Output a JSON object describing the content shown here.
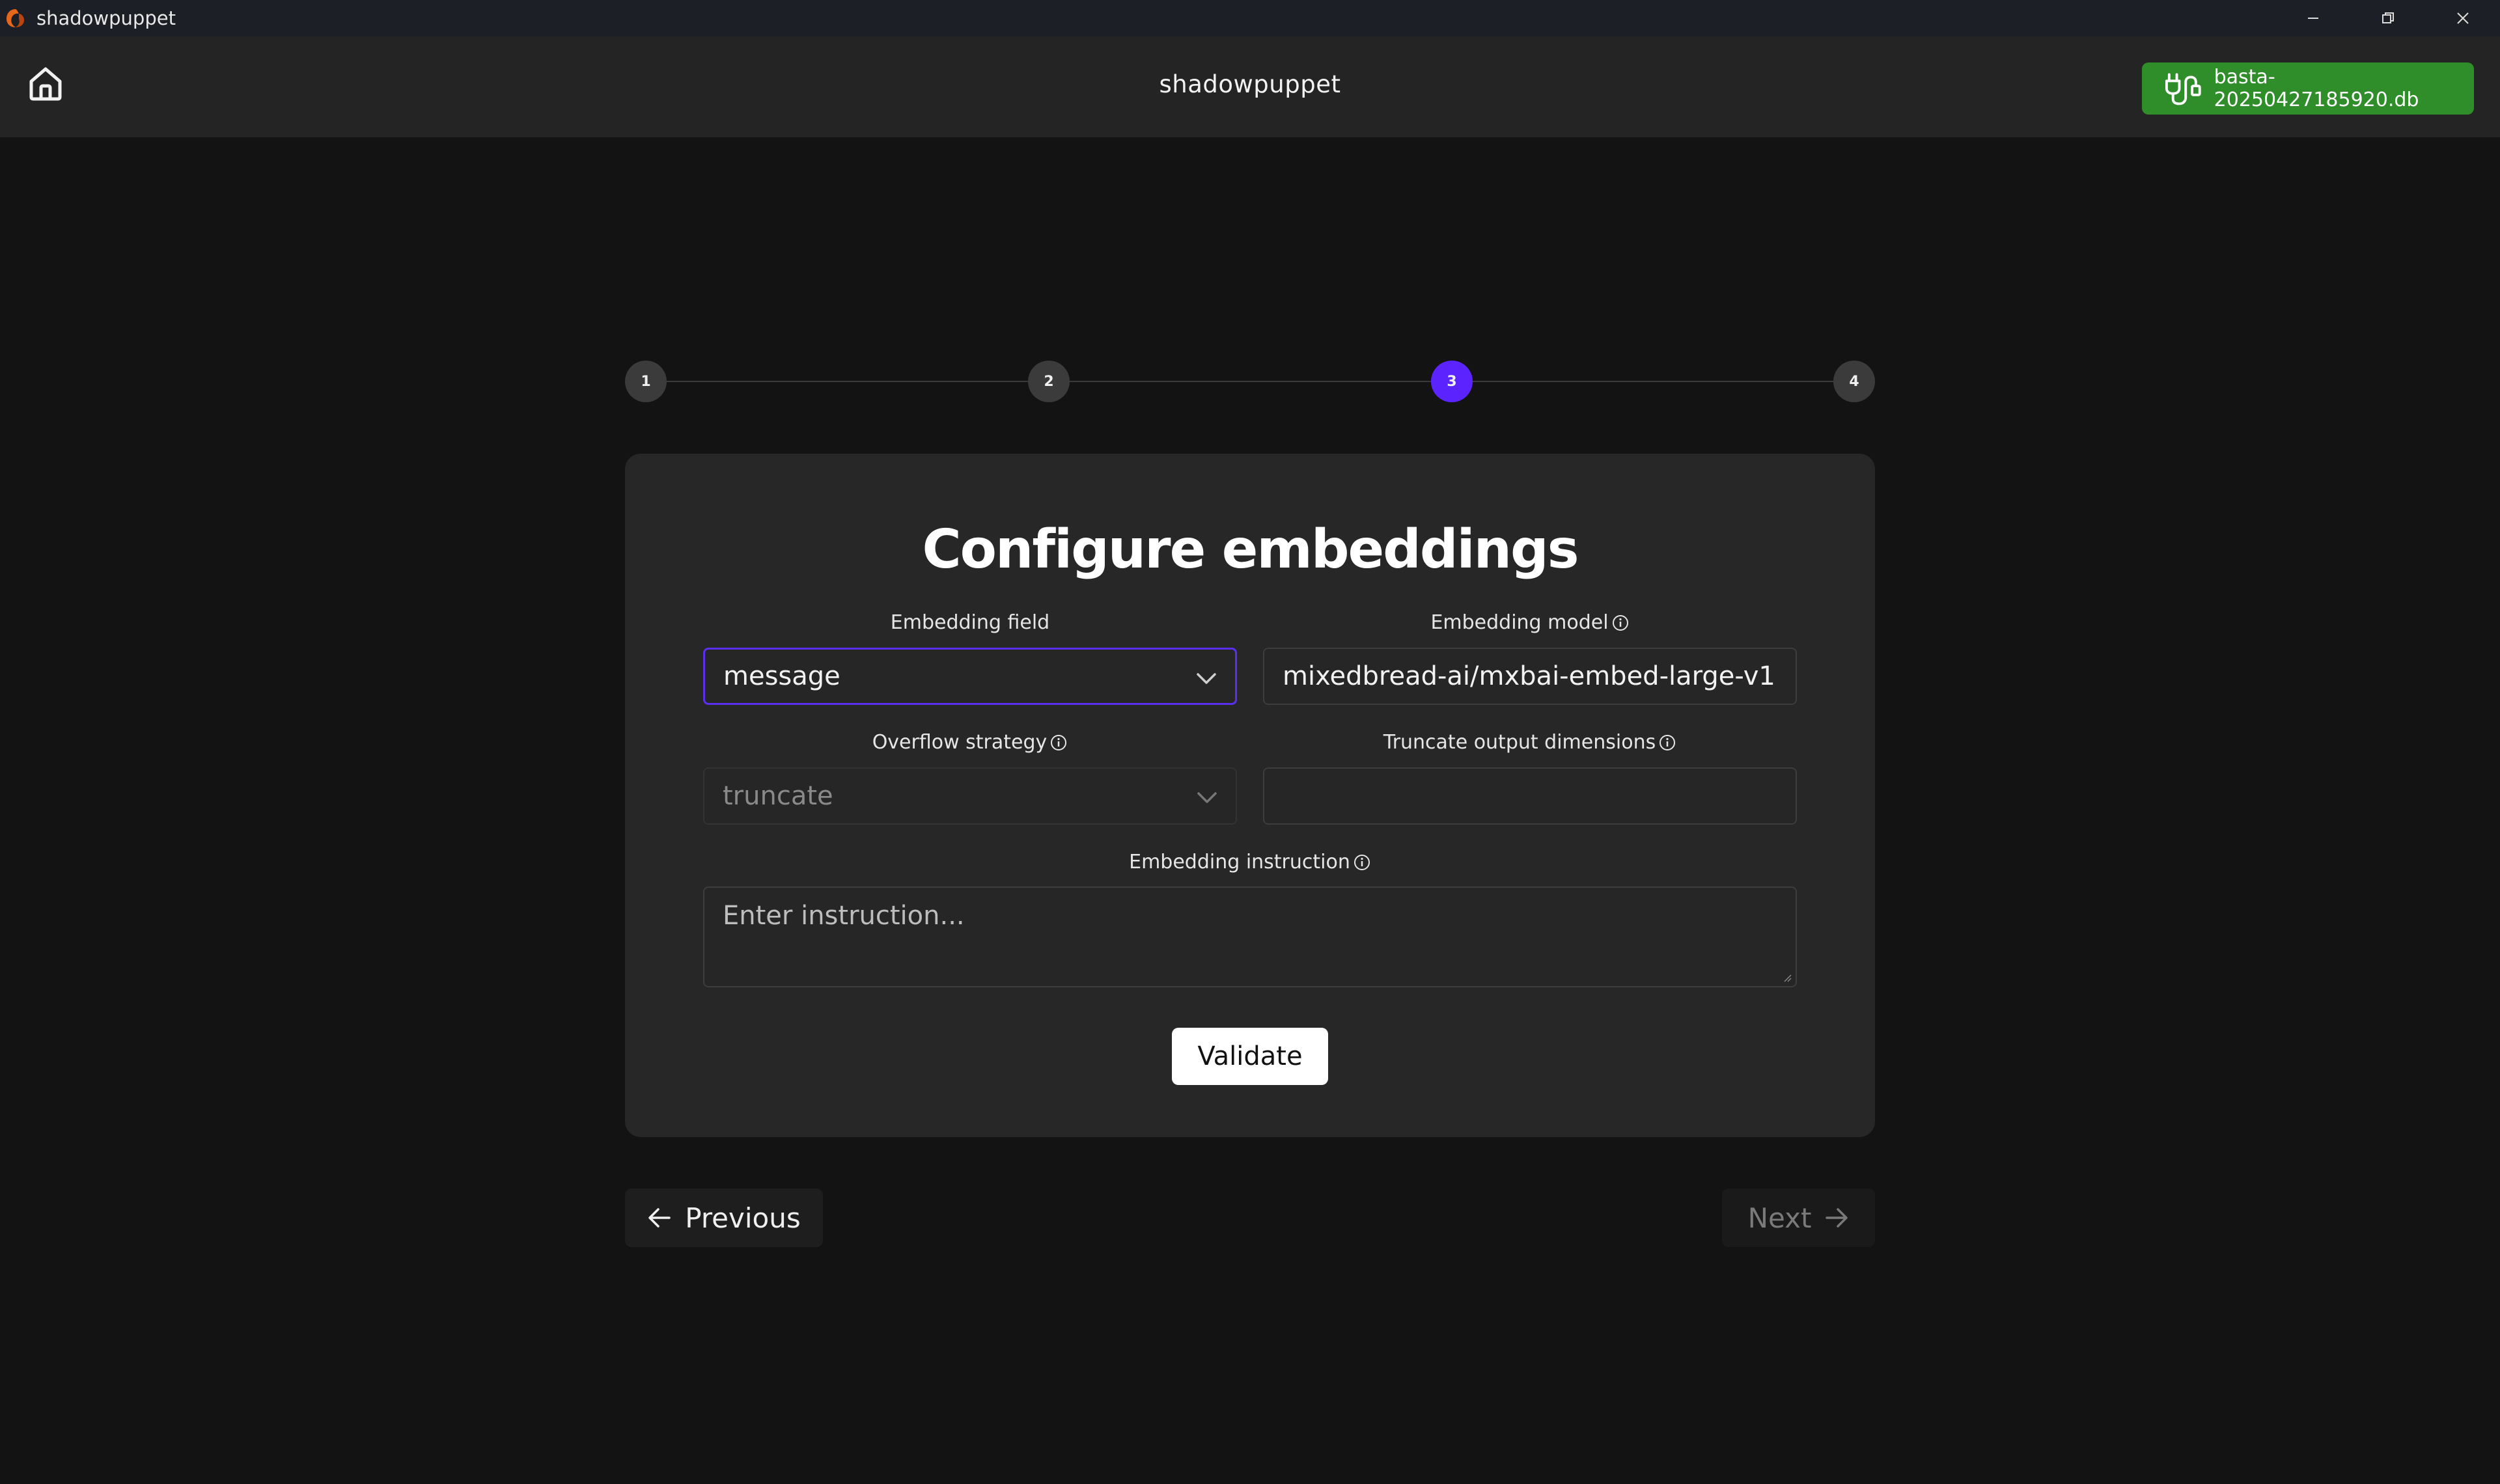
{
  "window": {
    "title": "shadowpuppet",
    "controls": [
      "minimize-icon",
      "restore-icon",
      "close-icon"
    ]
  },
  "header": {
    "title": "shadowpuppet",
    "home_icon": "home-icon",
    "db_badge": {
      "icon": "plug-icon",
      "label": "basta-20250427185920.db",
      "color": "#2f8e2a"
    }
  },
  "stepper": {
    "steps": [
      "1",
      "2",
      "3",
      "4"
    ],
    "active_step": 3,
    "active_color": "#5b24ff"
  },
  "form": {
    "title": "Configure embeddings",
    "embedding_field": {
      "label": "Embedding field",
      "value": "message"
    },
    "embedding_model": {
      "label": "Embedding model",
      "value": "mixedbread-ai/mxbai-embed-large-v1"
    },
    "overflow_strategy": {
      "label": "Overflow strategy",
      "value": "truncate"
    },
    "truncate_dimensions": {
      "label": "Truncate output dimensions",
      "value": ""
    },
    "embedding_instruction": {
      "label": "Embedding instruction",
      "placeholder": "Enter instruction..."
    },
    "validate_label": "Validate"
  },
  "nav": {
    "previous_label": "Previous",
    "next_label": "Next"
  }
}
